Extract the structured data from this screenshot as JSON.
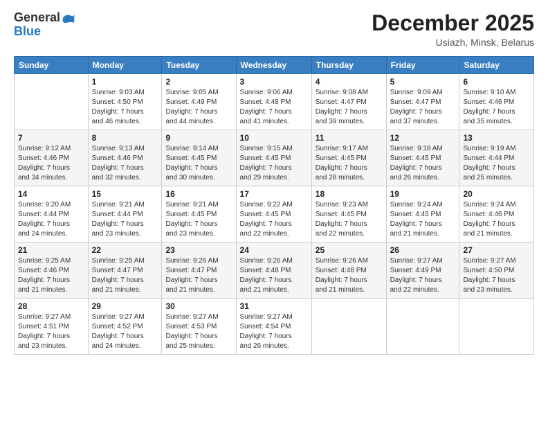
{
  "logo": {
    "general": "General",
    "blue": "Blue"
  },
  "header": {
    "month": "December 2025",
    "location": "Usiazh, Minsk, Belarus"
  },
  "days_of_week": [
    "Sunday",
    "Monday",
    "Tuesday",
    "Wednesday",
    "Thursday",
    "Friday",
    "Saturday"
  ],
  "weeks": [
    [
      {
        "day": "",
        "info": ""
      },
      {
        "day": "1",
        "info": "Sunrise: 9:03 AM\nSunset: 4:50 PM\nDaylight: 7 hours\nand 46 minutes."
      },
      {
        "day": "2",
        "info": "Sunrise: 9:05 AM\nSunset: 4:49 PM\nDaylight: 7 hours\nand 44 minutes."
      },
      {
        "day": "3",
        "info": "Sunrise: 9:06 AM\nSunset: 4:48 PM\nDaylight: 7 hours\nand 41 minutes."
      },
      {
        "day": "4",
        "info": "Sunrise: 9:08 AM\nSunset: 4:47 PM\nDaylight: 7 hours\nand 39 minutes."
      },
      {
        "day": "5",
        "info": "Sunrise: 9:09 AM\nSunset: 4:47 PM\nDaylight: 7 hours\nand 37 minutes."
      },
      {
        "day": "6",
        "info": "Sunrise: 9:10 AM\nSunset: 4:46 PM\nDaylight: 7 hours\nand 35 minutes."
      }
    ],
    [
      {
        "day": "7",
        "info": "Sunrise: 9:12 AM\nSunset: 4:46 PM\nDaylight: 7 hours\nand 34 minutes."
      },
      {
        "day": "8",
        "info": "Sunrise: 9:13 AM\nSunset: 4:46 PM\nDaylight: 7 hours\nand 32 minutes."
      },
      {
        "day": "9",
        "info": "Sunrise: 9:14 AM\nSunset: 4:45 PM\nDaylight: 7 hours\nand 30 minutes."
      },
      {
        "day": "10",
        "info": "Sunrise: 9:15 AM\nSunset: 4:45 PM\nDaylight: 7 hours\nand 29 minutes."
      },
      {
        "day": "11",
        "info": "Sunrise: 9:17 AM\nSunset: 4:45 PM\nDaylight: 7 hours\nand 28 minutes."
      },
      {
        "day": "12",
        "info": "Sunrise: 9:18 AM\nSunset: 4:45 PM\nDaylight: 7 hours\nand 26 minutes."
      },
      {
        "day": "13",
        "info": "Sunrise: 9:19 AM\nSunset: 4:44 PM\nDaylight: 7 hours\nand 25 minutes."
      }
    ],
    [
      {
        "day": "14",
        "info": "Sunrise: 9:20 AM\nSunset: 4:44 PM\nDaylight: 7 hours\nand 24 minutes."
      },
      {
        "day": "15",
        "info": "Sunrise: 9:21 AM\nSunset: 4:44 PM\nDaylight: 7 hours\nand 23 minutes."
      },
      {
        "day": "16",
        "info": "Sunrise: 9:21 AM\nSunset: 4:45 PM\nDaylight: 7 hours\nand 23 minutes."
      },
      {
        "day": "17",
        "info": "Sunrise: 9:22 AM\nSunset: 4:45 PM\nDaylight: 7 hours\nand 22 minutes."
      },
      {
        "day": "18",
        "info": "Sunrise: 9:23 AM\nSunset: 4:45 PM\nDaylight: 7 hours\nand 22 minutes."
      },
      {
        "day": "19",
        "info": "Sunrise: 9:24 AM\nSunset: 4:45 PM\nDaylight: 7 hours\nand 21 minutes."
      },
      {
        "day": "20",
        "info": "Sunrise: 9:24 AM\nSunset: 4:46 PM\nDaylight: 7 hours\nand 21 minutes."
      }
    ],
    [
      {
        "day": "21",
        "info": "Sunrise: 9:25 AM\nSunset: 4:46 PM\nDaylight: 7 hours\nand 21 minutes."
      },
      {
        "day": "22",
        "info": "Sunrise: 9:25 AM\nSunset: 4:47 PM\nDaylight: 7 hours\nand 21 minutes."
      },
      {
        "day": "23",
        "info": "Sunrise: 9:26 AM\nSunset: 4:47 PM\nDaylight: 7 hours\nand 21 minutes."
      },
      {
        "day": "24",
        "info": "Sunrise: 9:26 AM\nSunset: 4:48 PM\nDaylight: 7 hours\nand 21 minutes."
      },
      {
        "day": "25",
        "info": "Sunrise: 9:26 AM\nSunset: 4:48 PM\nDaylight: 7 hours\nand 21 minutes."
      },
      {
        "day": "26",
        "info": "Sunrise: 9:27 AM\nSunset: 4:49 PM\nDaylight: 7 hours\nand 22 minutes."
      },
      {
        "day": "27",
        "info": "Sunrise: 9:27 AM\nSunset: 4:50 PM\nDaylight: 7 hours\nand 23 minutes."
      }
    ],
    [
      {
        "day": "28",
        "info": "Sunrise: 9:27 AM\nSunset: 4:51 PM\nDaylight: 7 hours\nand 23 minutes."
      },
      {
        "day": "29",
        "info": "Sunrise: 9:27 AM\nSunset: 4:52 PM\nDaylight: 7 hours\nand 24 minutes."
      },
      {
        "day": "30",
        "info": "Sunrise: 9:27 AM\nSunset: 4:53 PM\nDaylight: 7 hours\nand 25 minutes."
      },
      {
        "day": "31",
        "info": "Sunrise: 9:27 AM\nSunset: 4:54 PM\nDaylight: 7 hours\nand 26 minutes."
      },
      {
        "day": "",
        "info": ""
      },
      {
        "day": "",
        "info": ""
      },
      {
        "day": "",
        "info": ""
      }
    ]
  ]
}
